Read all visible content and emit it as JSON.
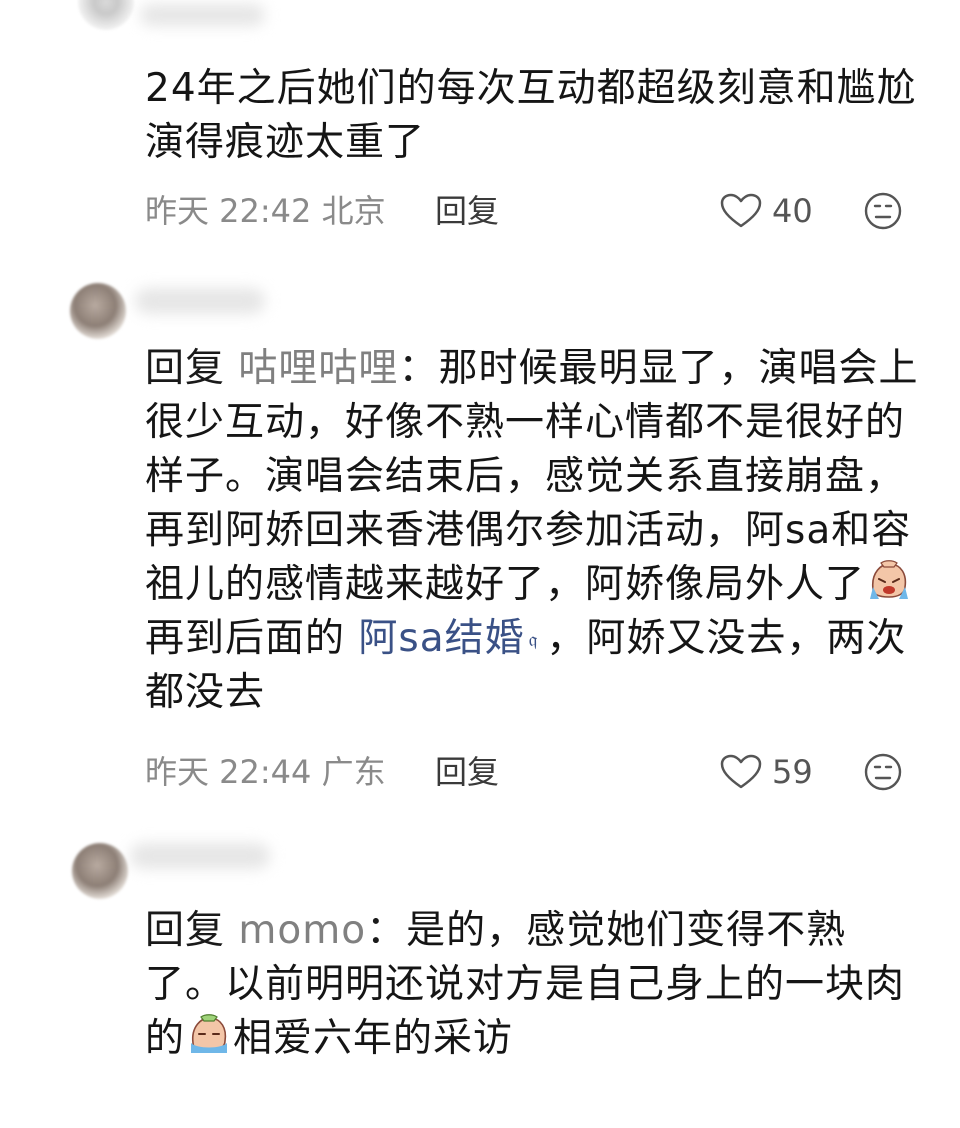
{
  "comments": [
    {
      "text": "24年之后她们的每次互动都超级刻意和尴尬 演得痕迹太重了",
      "time": "昨天 22:42 北京",
      "reply_label": "回复",
      "likes": "40"
    },
    {
      "reply_prefix": "回复",
      "reply_to": "咕哩咕哩",
      "colon": "：",
      "text_a": "那时候最明显了，演唱会上很少互动，好像不熟一样心情都不是很好的样子。演唱会结束后，感觉关系直接崩盘，再到阿娇回来香港偶尔参加活动，阿sa和容祖儿的感情越来越好了，阿娇像局外人了",
      "emoji": "crying-face-emoji",
      "text_b": "再到后面的",
      "link": "阿sa结婚",
      "text_c": "，阿娇又没去，两次都没去",
      "time": "昨天 22:44 广东",
      "reply_label": "回复",
      "likes": "59"
    },
    {
      "reply_prefix": "回复",
      "reply_to": "momo",
      "colon": "：",
      "text_a": "是的，感觉她们变得不熟了。以前明明还说对方是自己身上的一块肉的",
      "emoji": "crying-face-emoji",
      "text_b": "相爱六年的采访"
    }
  ],
  "colors": {
    "text": "#151515",
    "meta": "#8a8a8a",
    "reply_target": "#808080",
    "link": "#3a5186"
  }
}
